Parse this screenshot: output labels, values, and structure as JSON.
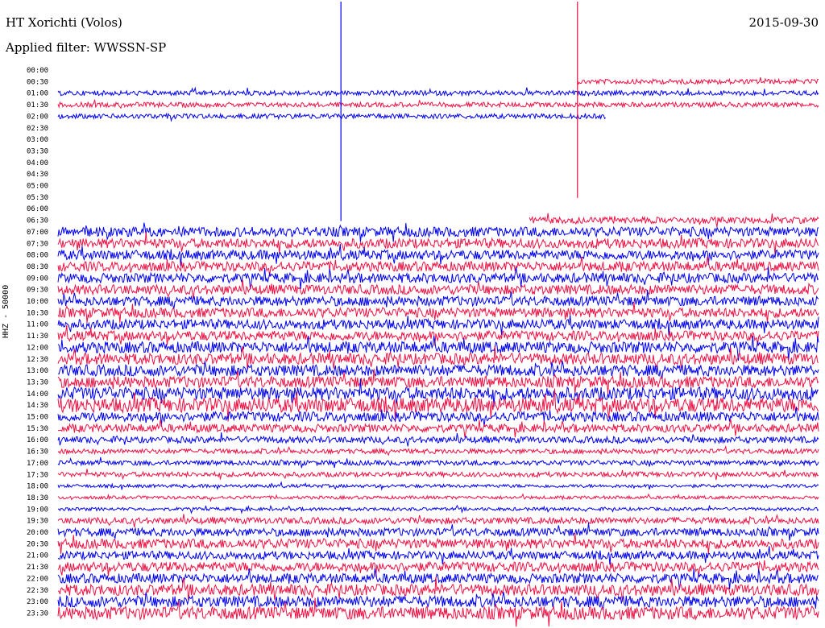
{
  "header": {
    "station": "HT Xorichti (Volos)",
    "filter": "Applied filter: WWSSN-SP",
    "date": "2015-09-30"
  },
  "chart_data": {
    "type": "line",
    "title": "HT Xorichti (Volos)",
    "subtitle": "Applied filter: WWSSN-SP",
    "date": "2015-09-30",
    "ylabel": "HHZ - 50000",
    "row_labels": [
      "00:00",
      "00:30",
      "01:00",
      "01:30",
      "02:00",
      "02:30",
      "03:00",
      "03:30",
      "04:00",
      "04:30",
      "05:00",
      "05:30",
      "06:00",
      "06:30",
      "07:00",
      "07:30",
      "08:00",
      "08:30",
      "09:00",
      "09:30",
      "10:00",
      "10:30",
      "11:00",
      "11:30",
      "12:00",
      "12:30",
      "13:00",
      "13:30",
      "14:00",
      "14:30",
      "15:00",
      "15:30",
      "16:00",
      "16:30",
      "17:00",
      "17:30",
      "18:00",
      "18:30",
      "19:00",
      "19:30",
      "20:00",
      "20:30",
      "21:00",
      "21:30",
      "22:00",
      "22:30",
      "23:00",
      "23:30"
    ],
    "series_colors": [
      "#0000ee",
      "#ee1144"
    ],
    "traces": [
      {
        "label": "00:30",
        "start": 0.683,
        "end": 1.0,
        "amp": 3
      },
      {
        "label": "01:00",
        "start": 0.0,
        "end": 1.0,
        "amp": 3
      },
      {
        "label": "01:30",
        "start": 0.0,
        "end": 1.0,
        "amp": 3
      },
      {
        "label": "02:00",
        "start": 0.0,
        "end": 0.72,
        "amp": 3
      },
      {
        "label": "06:30",
        "start": 0.62,
        "end": 1.0,
        "amp": 4
      },
      {
        "label": "07:00",
        "start": 0.0,
        "end": 1.0,
        "amp": 6
      },
      {
        "label": "07:30",
        "start": 0.0,
        "end": 1.0,
        "amp": 6
      },
      {
        "label": "08:00",
        "start": 0.0,
        "end": 1.0,
        "amp": 6
      },
      {
        "label": "08:30",
        "start": 0.0,
        "end": 1.0,
        "amp": 6
      },
      {
        "label": "09:00",
        "start": 0.0,
        "end": 1.0,
        "amp": 6
      },
      {
        "label": "09:30",
        "start": 0.0,
        "end": 1.0,
        "amp": 6
      },
      {
        "label": "10:00",
        "start": 0.0,
        "end": 1.0,
        "amp": 6
      },
      {
        "label": "10:30",
        "start": 0.0,
        "end": 1.0,
        "amp": 6
      },
      {
        "label": "11:00",
        "start": 0.0,
        "end": 1.0,
        "amp": 6
      },
      {
        "label": "11:30",
        "start": 0.0,
        "end": 1.0,
        "amp": 6
      },
      {
        "label": "12:00",
        "start": 0.0,
        "end": 1.0,
        "amp": 7
      },
      {
        "label": "12:30",
        "start": 0.0,
        "end": 1.0,
        "amp": 7
      },
      {
        "label": "13:00",
        "start": 0.0,
        "end": 1.0,
        "amp": 7
      },
      {
        "label": "13:30",
        "start": 0.0,
        "end": 1.0,
        "amp": 7
      },
      {
        "label": "14:00",
        "start": 0.0,
        "end": 1.0,
        "amp": 8
      },
      {
        "label": "14:30",
        "start": 0.0,
        "end": 1.0,
        "amp": 9
      },
      {
        "label": "15:00",
        "start": 0.0,
        "end": 1.0,
        "amp": 6
      },
      {
        "label": "15:30",
        "start": 0.0,
        "end": 1.0,
        "amp": 5
      },
      {
        "label": "16:00",
        "start": 0.0,
        "end": 1.0,
        "amp": 4
      },
      {
        "label": "16:30",
        "start": 0.0,
        "end": 1.0,
        "amp": 3
      },
      {
        "label": "17:00",
        "start": 0.0,
        "end": 1.0,
        "amp": 3
      },
      {
        "label": "17:30",
        "start": 0.0,
        "end": 1.0,
        "amp": 3
      },
      {
        "label": "18:00",
        "start": 0.0,
        "end": 1.0,
        "amp": 2
      },
      {
        "label": "18:30",
        "start": 0.0,
        "end": 1.0,
        "amp": 2
      },
      {
        "label": "19:00",
        "start": 0.0,
        "end": 1.0,
        "amp": 2
      },
      {
        "label": "19:30",
        "start": 0.0,
        "end": 1.0,
        "amp": 4
      },
      {
        "label": "20:00",
        "start": 0.0,
        "end": 1.0,
        "amp": 5
      },
      {
        "label": "20:30",
        "start": 0.0,
        "end": 1.0,
        "amp": 6
      },
      {
        "label": "21:00",
        "start": 0.0,
        "end": 1.0,
        "amp": 5
      },
      {
        "label": "21:30",
        "start": 0.0,
        "end": 1.0,
        "amp": 6
      },
      {
        "label": "22:00",
        "start": 0.0,
        "end": 1.0,
        "amp": 6
      },
      {
        "label": "22:30",
        "start": 0.0,
        "end": 1.0,
        "amp": 7
      },
      {
        "label": "23:00",
        "start": 0.0,
        "end": 1.0,
        "amp": 7
      },
      {
        "label": "23:30",
        "start": 0.0,
        "end": 1.0,
        "amp": 8
      }
    ],
    "spikes": [
      {
        "time_fraction": 0.372,
        "from_label": "00:00",
        "to_label": "06:30"
      },
      {
        "time_fraction": 0.683,
        "from_label": "00:00",
        "to_label": "05:30"
      }
    ]
  }
}
